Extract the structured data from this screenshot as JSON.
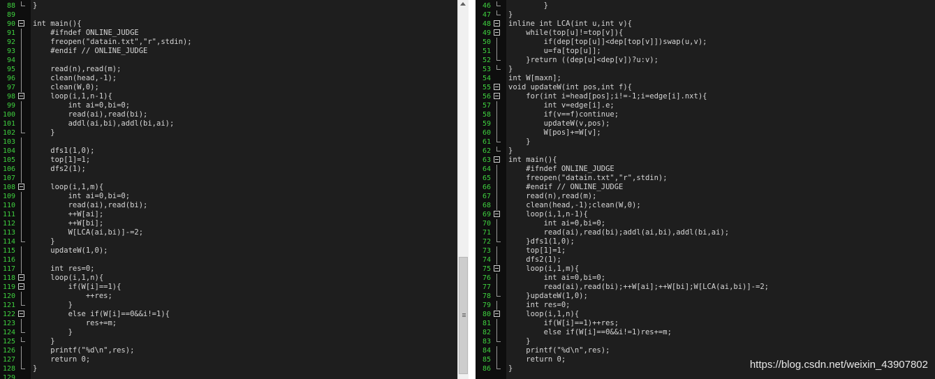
{
  "colors": {
    "editor_bg": "#1e1e1e",
    "gutter_bg": "#0e0e0e",
    "line_number": "#3fd13f",
    "code_text": "#d6d6d6",
    "watermark": "#e8e8e8"
  },
  "left_pane": {
    "lines": [
      {
        "num": "88",
        "text": "}",
        "marker": "end"
      },
      {
        "num": "89",
        "text": "",
        "marker": ""
      },
      {
        "num": "90",
        "text": "int main(){",
        "marker": "fold"
      },
      {
        "num": "91",
        "text": "    #ifndef ONLINE_JUDGE",
        "marker": "guide"
      },
      {
        "num": "92",
        "text": "    freopen(\"datain.txt\",\"r\",stdin);",
        "marker": "guide"
      },
      {
        "num": "93",
        "text": "    #endif // ONLINE_JUDGE",
        "marker": "guide"
      },
      {
        "num": "94",
        "text": "",
        "marker": "guide"
      },
      {
        "num": "95",
        "text": "    read(n),read(m);",
        "marker": "guide"
      },
      {
        "num": "96",
        "text": "    clean(head,-1);",
        "marker": "guide"
      },
      {
        "num": "97",
        "text": "    clean(W,0);",
        "marker": "guide"
      },
      {
        "num": "98",
        "text": "    loop(i,1,n-1){",
        "marker": "fold"
      },
      {
        "num": "99",
        "text": "        int ai=0,bi=0;",
        "marker": "guide"
      },
      {
        "num": "100",
        "text": "        read(ai),read(bi);",
        "marker": "guide"
      },
      {
        "num": "101",
        "text": "        addl(ai,bi),addl(bi,ai);",
        "marker": "guide"
      },
      {
        "num": "102",
        "text": "    }",
        "marker": "end"
      },
      {
        "num": "103",
        "text": "",
        "marker": "guide"
      },
      {
        "num": "104",
        "text": "    dfs1(1,0);",
        "marker": "guide"
      },
      {
        "num": "105",
        "text": "    top[1]=1;",
        "marker": "guide"
      },
      {
        "num": "106",
        "text": "    dfs2(1);",
        "marker": "guide"
      },
      {
        "num": "107",
        "text": "",
        "marker": "guide"
      },
      {
        "num": "108",
        "text": "    loop(i,1,m){",
        "marker": "fold"
      },
      {
        "num": "109",
        "text": "        int ai=0,bi=0;",
        "marker": "guide"
      },
      {
        "num": "110",
        "text": "        read(ai),read(bi);",
        "marker": "guide"
      },
      {
        "num": "111",
        "text": "        ++W[ai];",
        "marker": "guide"
      },
      {
        "num": "112",
        "text": "        ++W[bi];",
        "marker": "guide"
      },
      {
        "num": "113",
        "text": "        W[LCA(ai,bi)]-=2;",
        "marker": "guide"
      },
      {
        "num": "114",
        "text": "    }",
        "marker": "end"
      },
      {
        "num": "115",
        "text": "    updateW(1,0);",
        "marker": "guide"
      },
      {
        "num": "116",
        "text": "",
        "marker": "guide"
      },
      {
        "num": "117",
        "text": "    int res=0;",
        "marker": "guide"
      },
      {
        "num": "118",
        "text": "    loop(i,1,n){",
        "marker": "fold"
      },
      {
        "num": "119",
        "text": "        if(W[i]==1){",
        "marker": "fold"
      },
      {
        "num": "120",
        "text": "            ++res;",
        "marker": "guide"
      },
      {
        "num": "121",
        "text": "        }",
        "marker": "end"
      },
      {
        "num": "122",
        "text": "        else if(W[i]==0&&i!=1){",
        "marker": "fold"
      },
      {
        "num": "123",
        "text": "            res+=m;",
        "marker": "guide"
      },
      {
        "num": "124",
        "text": "        }",
        "marker": "end"
      },
      {
        "num": "125",
        "text": "    }",
        "marker": "end"
      },
      {
        "num": "126",
        "text": "    printf(\"%d\\n\",res);",
        "marker": "guide"
      },
      {
        "num": "127",
        "text": "    return 0;",
        "marker": "guide"
      },
      {
        "num": "128",
        "text": "}",
        "marker": "end"
      },
      {
        "num": "129",
        "text": "",
        "marker": ""
      }
    ]
  },
  "right_pane": {
    "lines": [
      {
        "num": "46",
        "text": "        }",
        "marker": "end"
      },
      {
        "num": "47",
        "text": "}",
        "marker": "end"
      },
      {
        "num": "48",
        "text": "inline int LCA(int u,int v){",
        "marker": "fold"
      },
      {
        "num": "49",
        "text": "    while(top[u]!=top[v]){",
        "marker": "fold"
      },
      {
        "num": "50",
        "text": "        if(dep[top[u]]<dep[top[v]])swap(u,v);",
        "marker": "guide"
      },
      {
        "num": "51",
        "text": "        u=fa[top[u]];",
        "marker": "guide"
      },
      {
        "num": "52",
        "text": "    }return ((dep[u]<dep[v])?u:v);",
        "marker": "end"
      },
      {
        "num": "53",
        "text": "}",
        "marker": "end"
      },
      {
        "num": "54",
        "text": "int W[maxn];",
        "marker": ""
      },
      {
        "num": "55",
        "text": "void updateW(int pos,int f){",
        "marker": "fold"
      },
      {
        "num": "56",
        "text": "    for(int i=head[pos];i!=-1;i=edge[i].nxt){",
        "marker": "fold"
      },
      {
        "num": "57",
        "text": "        int v=edge[i].e;",
        "marker": "guide"
      },
      {
        "num": "58",
        "text": "        if(v==f)continue;",
        "marker": "guide"
      },
      {
        "num": "59",
        "text": "        updateW(v,pos);",
        "marker": "guide"
      },
      {
        "num": "60",
        "text": "        W[pos]+=W[v];",
        "marker": "guide"
      },
      {
        "num": "61",
        "text": "    }",
        "marker": "end"
      },
      {
        "num": "62",
        "text": "}",
        "marker": "end"
      },
      {
        "num": "63",
        "text": "int main(){",
        "marker": "fold"
      },
      {
        "num": "64",
        "text": "    #ifndef ONLINE_JUDGE",
        "marker": "guide"
      },
      {
        "num": "65",
        "text": "    freopen(\"datain.txt\",\"r\",stdin);",
        "marker": "guide"
      },
      {
        "num": "66",
        "text": "    #endif // ONLINE_JUDGE",
        "marker": "guide"
      },
      {
        "num": "67",
        "text": "    read(n),read(m);",
        "marker": "guide"
      },
      {
        "num": "68",
        "text": "    clean(head,-1);clean(W,0);",
        "marker": "guide"
      },
      {
        "num": "69",
        "text": "    loop(i,1,n-1){",
        "marker": "fold"
      },
      {
        "num": "70",
        "text": "        int ai=0,bi=0;",
        "marker": "guide"
      },
      {
        "num": "71",
        "text": "        read(ai),read(bi);addl(ai,bi),addl(bi,ai);",
        "marker": "guide"
      },
      {
        "num": "72",
        "text": "    }dfs1(1,0);",
        "marker": "end"
      },
      {
        "num": "73",
        "text": "    top[1]=1;",
        "marker": "guide"
      },
      {
        "num": "74",
        "text": "    dfs2(1);",
        "marker": "guide"
      },
      {
        "num": "75",
        "text": "    loop(i,1,m){",
        "marker": "fold"
      },
      {
        "num": "76",
        "text": "        int ai=0,bi=0;",
        "marker": "guide"
      },
      {
        "num": "77",
        "text": "        read(ai),read(bi);++W[ai];++W[bi];W[LCA(ai,bi)]-=2;",
        "marker": "guide"
      },
      {
        "num": "78",
        "text": "    }updateW(1,0);",
        "marker": "end"
      },
      {
        "num": "79",
        "text": "    int res=0;",
        "marker": "guide"
      },
      {
        "num": "80",
        "text": "    loop(i,1,n){",
        "marker": "fold"
      },
      {
        "num": "81",
        "text": "        if(W[i]==1)++res;",
        "marker": "guide"
      },
      {
        "num": "82",
        "text": "        else if(W[i]==0&&i!=1)res+=m;",
        "marker": "guide"
      },
      {
        "num": "83",
        "text": "    }",
        "marker": "end"
      },
      {
        "num": "84",
        "text": "    printf(\"%d\\n\",res);",
        "marker": "guide"
      },
      {
        "num": "85",
        "text": "    return 0;",
        "marker": "guide"
      },
      {
        "num": "86",
        "text": "}",
        "marker": "end"
      }
    ]
  },
  "watermark": "https://blog.csdn.net/weixin_43907802"
}
